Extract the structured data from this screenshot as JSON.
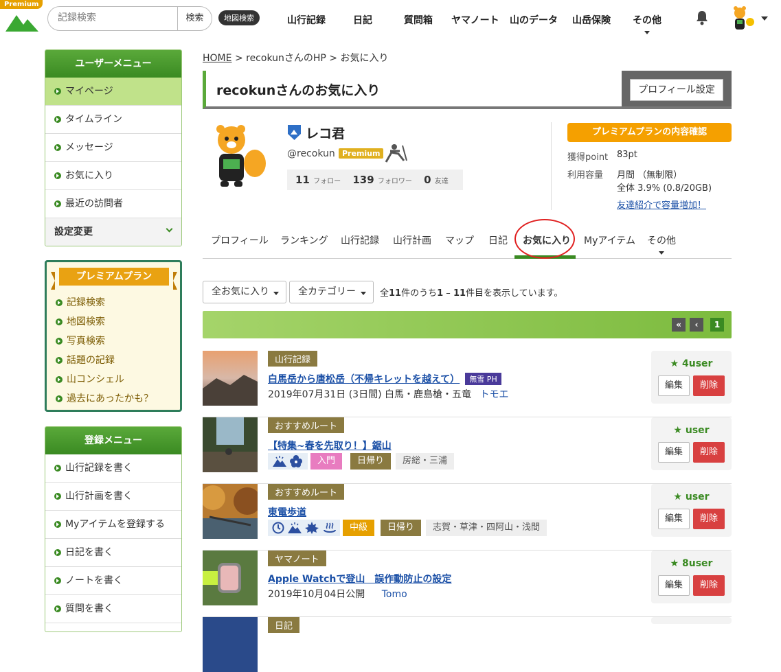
{
  "header": {
    "premium_tag": "Premium",
    "search_placeholder": "記録検索",
    "search_button": "検索",
    "map_search": "地図検索",
    "nav": [
      "山行記録",
      "日記",
      "質問箱",
      "ヤマノート",
      "山のデータ",
      "山岳保険",
      "その他"
    ]
  },
  "sidebar": {
    "user_menu_title": "ユーザーメニュー",
    "user_items": [
      "マイページ",
      "タイムライン",
      "メッセージ",
      "お気に入り",
      "最近の訪問者"
    ],
    "settings": "設定変更",
    "premium_title": "プレミアムプラン",
    "premium_items": [
      "記録検索",
      "地図検索",
      "写真検索",
      "話題の記録",
      "山コンシェル",
      "過去にあったかも？"
    ],
    "register_title": "登録メニュー",
    "register_items": [
      "山行記録を書く",
      "山行計画を書く",
      "Myアイテムを登録する",
      "日記を書く",
      "ノートを書く",
      "質問を書く"
    ]
  },
  "breadcrumb": {
    "home": "HOME",
    "sep": ">",
    "hp": "recokunさんのHP",
    "current": "お気に入り"
  },
  "page_title": "recokunさんのお気に入り",
  "profile_settings": "プロフィール設定",
  "profile": {
    "name": "レコ君",
    "handle": "@recokun",
    "badge": "Premium",
    "follow_count": "11",
    "follow_label": "フォロー",
    "follower_count": "139",
    "follower_label": "フォロワー",
    "friend_count": "0",
    "friend_label": "友達",
    "premium_confirm": "プレミアムプランの内容確認",
    "points_label": "獲得point",
    "points_value": "83pt",
    "capacity_label": "利用容量",
    "capacity_monthly": "月間 （無制限）",
    "capacity_total": "全体 3.9% (0.8/20GB)",
    "referral": "友達紹介で容量増加！"
  },
  "tabs": [
    "プロフィール",
    "ランキング",
    "山行記録",
    "山行計画",
    "マップ",
    "日記",
    "お気に入り",
    "Myアイテム",
    "その他"
  ],
  "filters": {
    "all_fav": "全お気に入り",
    "all_cat": "全カテゴリー"
  },
  "count_text": {
    "p1": "全",
    "total": "11",
    "p2": "件のうち",
    "from": "1",
    "p3": " – ",
    "to": "11",
    "p4": "件目を表示しています。"
  },
  "pager": {
    "first": "«",
    "prev": "‹",
    "current": "1"
  },
  "items": [
    {
      "category": "山行記録",
      "title": "白馬岳から唐松岳（不帰キレットを越えて）",
      "badge": "無雪 PH",
      "meta": "2019年07月31日 (3日間) 白馬・鹿島槍・五竜",
      "author": "トモエ",
      "users": "4user",
      "edit": "編集",
      "delete": "削除"
    },
    {
      "category": "おすすめルート",
      "title": "【特集~春を先取り！】鋸山",
      "level": "入門",
      "daytrip": "日帰り",
      "area": "房総・三浦",
      "users": "user",
      "edit": "編集",
      "delete": "削除"
    },
    {
      "category": "おすすめルート",
      "title": "東電歩道",
      "level": "中級",
      "daytrip": "日帰り",
      "area": "志賀・草津・四阿山・浅間",
      "users": "user",
      "edit": "編集",
      "delete": "削除"
    },
    {
      "category": "ヤマノート",
      "title": "Apple Watchで登山　誤作動防止の設定",
      "meta": "2019年10月04日公開",
      "author": "Tomo",
      "users": "8user",
      "edit": "編集",
      "delete": "削除"
    },
    {
      "category": "日記"
    }
  ],
  "colors": {
    "green": "#3a8a22",
    "orange": "#f5a000",
    "red": "#d84040"
  }
}
